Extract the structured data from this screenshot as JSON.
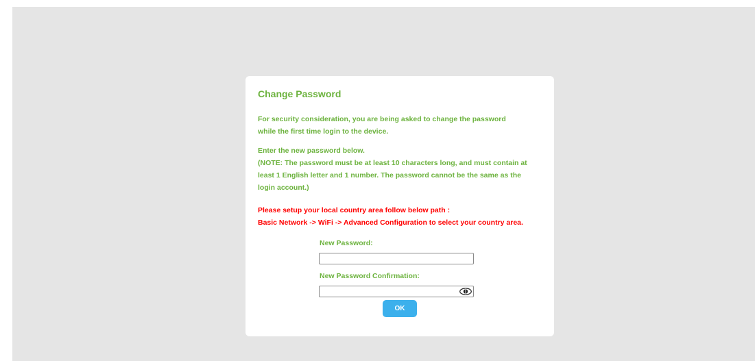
{
  "dialog": {
    "title": "Change Password",
    "intro_lines": [
      "For security consideration, you are being asked to change the password",
      "while the first time login to the device."
    ],
    "note_lines": [
      "Enter the new password below.",
      "(NOTE: The password must be at least 10 characters long, and must contain at",
      "least 1 English letter and 1 number. The password cannot be the same as the",
      "login account.)"
    ],
    "warning_lines": [
      "Please setup your local country area follow below path :",
      "Basic Network -> WiFi -> Advanced Configuration to select your country area."
    ],
    "new_password": {
      "label": "New Password:",
      "value": ""
    },
    "confirm_password": {
      "label": "New Password Confirmation:",
      "value": "",
      "toggle_icon": "eye-icon"
    },
    "ok_label": "OK"
  },
  "colors": {
    "backdrop": "#e5e5e5",
    "accent_green": "#6db33f",
    "warning_red": "#ff0000",
    "button_blue": "#3cb0ec"
  }
}
